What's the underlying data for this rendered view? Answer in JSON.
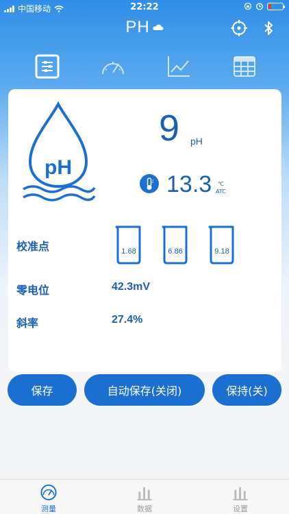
{
  "status_bar": {
    "carrier": "中国移动",
    "time": "22:22"
  },
  "header": {
    "title": "PH",
    "icons": [
      "cloud-icon",
      "crosshair-icon",
      "bluetooth-icon"
    ]
  },
  "top_tabs": [
    {
      "icon": "list-settings-icon",
      "active": true
    },
    {
      "icon": "gauge-icon",
      "active": false
    },
    {
      "icon": "line-chart-icon",
      "active": false
    },
    {
      "icon": "table-icon",
      "active": false
    }
  ],
  "measurement": {
    "logo_text": "pH",
    "ph_value": "9",
    "ph_unit": "pH",
    "temperature": "13.3",
    "temp_unit": "℃",
    "temp_mode": "ATC"
  },
  "calibration": {
    "label": "校准点",
    "points": [
      "1.68",
      "6.86",
      "9.18"
    ]
  },
  "zero_potential": {
    "label": "零电位",
    "value": "42.3mV"
  },
  "slope": {
    "label": "斜率",
    "value": "27.4%"
  },
  "actions": {
    "save": "保存",
    "auto_save": "自动保存(关闭)",
    "hold": "保持(关)"
  },
  "bottom_nav": [
    {
      "label": "测量",
      "icon": "gauge-icon",
      "active": true
    },
    {
      "label": "数据",
      "icon": "bar-chart-icon",
      "active": false
    },
    {
      "label": "设置",
      "icon": "settings-bars-icon",
      "active": false
    }
  ],
  "colors": {
    "accent": "#1a6fd1",
    "text_blue": "#1a5fb5",
    "header_top": "#2f8ee8",
    "battery_low": "#e53935"
  }
}
